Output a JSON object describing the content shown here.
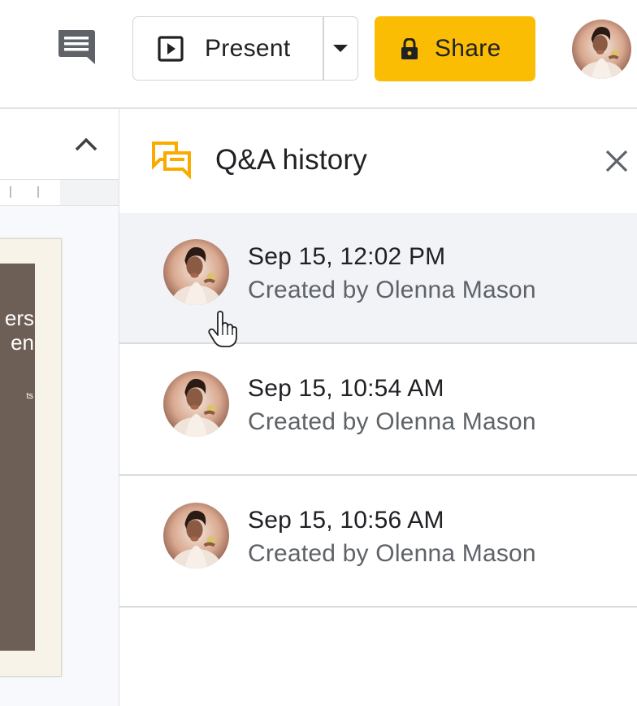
{
  "toolbar": {
    "comment_icon": "comment-icon",
    "present_label": "Present",
    "present_icon": "present-play-icon",
    "dropdown_icon": "caret-down-icon",
    "share_label": "Share",
    "share_icon": "lock-icon",
    "share_color": "#fbbc04",
    "account_avatar": "user-avatar"
  },
  "slides_panel": {
    "collapse_icon": "chevron-up-icon",
    "slide_text_lines": [
      "ers",
      "en"
    ],
    "slide_small_text": "ts"
  },
  "qa_panel": {
    "title": "Q&A history",
    "icon": "qa-chat-icon",
    "icon_color": "#f9ab00",
    "close_icon": "close-icon",
    "sessions": [
      {
        "time": "Sep 15, 12:02 PM",
        "creator": "Created by Olenna Mason"
      },
      {
        "time": "Sep 15, 10:54 AM",
        "creator": "Created by Olenna Mason"
      },
      {
        "time": "Sep 15, 10:56 AM",
        "creator": "Created by Olenna Mason"
      }
    ]
  }
}
